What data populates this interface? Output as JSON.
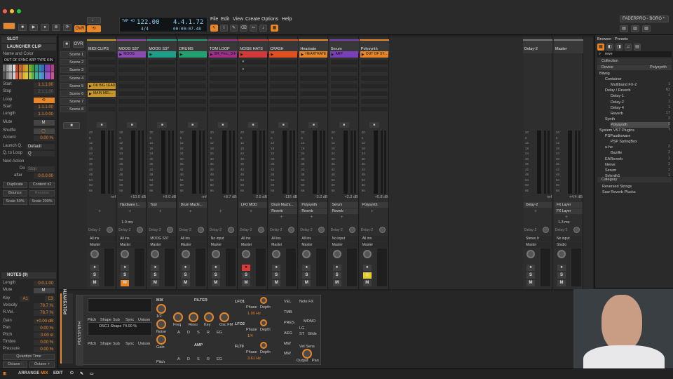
{
  "app": {
    "project_title": "FADERPRO - BORG *",
    "accent": "#e8862a"
  },
  "transport": {
    "ovr": "OVR",
    "tempo": "122.00",
    "sig": "4/4",
    "position": "4.4.1.72",
    "time": "00:00:07.48",
    "tempo_label": "TAP +D"
  },
  "menu": [
    "File",
    "Edit",
    "View",
    "Create",
    "Options",
    "Help"
  ],
  "inspector": {
    "slot": "SLOT",
    "launcher_clip": "LAUNCHER CLIP",
    "name_and_color": "Name and Color",
    "clip_name": "OUT OF SYNC ARP TYPE KIN",
    "start_label": "Start",
    "start": "1.1.1.00",
    "stop_label": "Stop",
    "stop": "2.1.1.00",
    "loop_label": "Loop",
    "loop_start_label": "Start",
    "loop_start": "1.1.1.00",
    "length_label": "Length",
    "length": "1.1.0.00",
    "mute_label": "Mute",
    "mute": "M",
    "shuffle_label": "Shuffle",
    "accent_label": "Accent",
    "accent": "0.00 %",
    "launch_q_label": "Launch Q.",
    "launch_q": "Default",
    "q_loop_label": "Q. to Loop",
    "q_loop": "Q",
    "next_action": "Next Action",
    "do_label": "Do",
    "do": "Stop",
    "after_label": "after",
    "after": "0.0.0.00",
    "buttons": [
      "Duplicate",
      "Content x2",
      "Bounce",
      "Reverse",
      "Scale 50%",
      "Scale 200%"
    ],
    "notes_header": "NOTES (9)",
    "n_length_label": "Length",
    "n_length": "0.0.1.00",
    "n_mute_label": "Mute",
    "n_mute": "M",
    "key_label": "Key",
    "key_from": "A1",
    "key_to": "C3",
    "velocity_label": "Velocity",
    "velocity": "78.7 %",
    "rvel_label": "R.Vel.",
    "rvel": "78.7 %",
    "gain_label": "Gain",
    "gain": "+0.00 dB",
    "pan_label": "Pan",
    "pan": "0.00 %",
    "pitch_label": "Pitch",
    "pitch": "0.00 st",
    "timbre_label": "Timbre",
    "timbre": "0.00 %",
    "pressure_label": "Pressure",
    "pressure": "0.00 %",
    "quantize": "Quantize Time",
    "octave_down": "Octave -",
    "octave_up": "Octave +"
  },
  "scenes": [
    "Scene 1",
    "Scene 2",
    "Scene 3",
    "Scene 4",
    "Scene 5",
    "Scene 6",
    "Scene 7",
    "Scene 8"
  ],
  "tracks": [
    {
      "name": "MIDI CLIPS",
      "color": "#c89628",
      "vol": "-inf",
      "device": "",
      "input": "All ins",
      "output": "Master",
      "clips": {
        "4": "DK BIG LEAD",
        "5": "MAIN MEL..."
      }
    },
    {
      "name": "MOOG S37",
      "color": "#8a4ab0",
      "vol": "+10.0 dB",
      "device": "Hardware I...",
      "input": "All ins",
      "output": "Master",
      "clips": {
        "0": "MOOG"
      },
      "extra": "1.0 ms"
    },
    {
      "name": "MOOG S37",
      "color": "#1f9e8a",
      "vol": "+9.0 dB",
      "device": "Tool",
      "input": "MOOG S37",
      "output": "Master",
      "clips": {
        "0": ""
      }
    },
    {
      "name": "DRUMS",
      "color": "#22a070",
      "vol": "-inf",
      "device": "Drum Machi...",
      "input": "All ins",
      "output": "Master",
      "clips": {
        "0": ""
      }
    },
    {
      "name": "TOM LOOP",
      "color": "#a0308a",
      "vol": "+8.7 dB",
      "device": "",
      "input": "No input",
      "output": "Master",
      "clips": {
        "0": "BR_Perc_Drh"
      }
    },
    {
      "name": "NOISE HATS",
      "color": "#d23a3a",
      "vol": "-2.5 dB",
      "device": "LFO MOD",
      "input": "All ins",
      "output": "Master",
      "clips": {
        "0": ""
      }
    },
    {
      "name": "CRASH",
      "color": "#e05020",
      "vol": "-116 dB",
      "device": "Drum Machi...",
      "device2": "Reverb",
      "input": "All ins",
      "output": "Master",
      "clips": {
        "0": ""
      }
    },
    {
      "name": "Heartrate",
      "color": "#e8862a",
      "vol": "-3.0 dB",
      "device": "Polysynth",
      "device2": "Reverb",
      "input": "All ins",
      "output": "Master",
      "clips": {
        "0": "HEARTRATE"
      }
    },
    {
      "name": "Serum",
      "color": "#7a40b8",
      "vol": "+2.3 dB",
      "device": "Serum",
      "device2": "Reverb",
      "input": "No input",
      "output": "Master",
      "clips": {
        "0": "ARP"
      }
    },
    {
      "name": "Polysynth",
      "color": "#e8862a",
      "vol": "+0.8 dB",
      "device": "Polysynth",
      "input": "All ins",
      "output": "Master",
      "clips": {
        "0": "OUT OF SY..."
      }
    }
  ],
  "fx": [
    {
      "name": "Delay-2",
      "vol": "-inf",
      "device": "Delay-2",
      "input": "Stereo Ir",
      "output": "Master"
    },
    {
      "name": "Master",
      "vol": "+4.4 dB",
      "device": "FX Layer",
      "device2": "FX Layer",
      "input": "No input",
      "output": "Studio",
      "extra": "1.3 ms"
    }
  ],
  "fader_scale": [
    "20",
    "6",
    "12",
    "18",
    "24",
    "30",
    "36",
    "42",
    "48",
    "54",
    "60",
    "66"
  ],
  "delay_label": "Delay-2",
  "browser": {
    "title": "Browser - Presets",
    "search": "reve",
    "collection": "Collection",
    "device": "Device",
    "filter": "Polysynth",
    "items": [
      {
        "label": "Bitwig",
        "count": "",
        "indent": 0
      },
      {
        "label": "Container",
        "count": "",
        "indent": 1
      },
      {
        "label": "Multiband FX-2",
        "count": "1",
        "indent": 2
      },
      {
        "label": "Delay / Reverb",
        "count": "62",
        "indent": 1
      },
      {
        "label": "Delay-1",
        "count": "1",
        "indent": 2
      },
      {
        "label": "Delay-2",
        "count": "1",
        "indent": 2
      },
      {
        "label": "Delay-4",
        "count": "1",
        "indent": 2
      },
      {
        "label": "Reverb",
        "count": "17",
        "indent": 2
      },
      {
        "label": "Synth",
        "count": "2",
        "indent": 1
      },
      {
        "label": "Polysynth",
        "count": "2",
        "indent": 2
      },
      {
        "label": "System VST Plugins",
        "count": "7",
        "indent": 0
      },
      {
        "label": "PSPaudioware",
        "count": "",
        "indent": 1
      },
      {
        "label": "PSP SpringBox",
        "count": "",
        "indent": 2
      },
      {
        "label": "u-he",
        "count": "2",
        "indent": 1
      },
      {
        "label": "Bazille",
        "count": "2",
        "indent": 2
      },
      {
        "label": "EAReverb",
        "count": "1",
        "indent": 1
      },
      {
        "label": "Nerve",
        "count": "1",
        "indent": 1
      },
      {
        "label": "Serum",
        "count": "1",
        "indent": 1
      },
      {
        "label": "Sylenth1",
        "count": "1",
        "indent": 1
      }
    ],
    "category": "Category",
    "results": [
      "Reversed Strings",
      "Saw Reverb Plucks"
    ]
  },
  "device_panel": {
    "track": "POLYSYNTH",
    "name": "POLYSYNTH",
    "mix": "MIX",
    "filter": "FILTER",
    "amp": "AMP",
    "lfo1": "LFO1",
    "lfo2": "LFO2",
    "flt0": "FLT0",
    "osc_labels": [
      "Pitch",
      "Shape",
      "Sub",
      "Sync",
      "Unison"
    ],
    "osc_readout": "OSC1 Shape 74.00 %",
    "filter_labels": [
      "Freq",
      "Reso",
      "Key",
      "Osc FM"
    ],
    "adsr": [
      "A",
      "D",
      "S",
      "R",
      "EG"
    ],
    "mix_labels": [
      "1/2",
      "Noise",
      "Gain"
    ],
    "lfo_vals": [
      "1.00 Hz",
      "1/4",
      "3.61 Hz"
    ],
    "phase": "Phase",
    "depth": "Depth",
    "right": [
      "VEL",
      "TMB",
      "PRES",
      "AEG",
      "MW",
      "NOTE FX",
      "MONO",
      "LG",
      "ST",
      "Glide",
      "Vel Sens",
      "Output",
      "Pan"
    ],
    "notefx": "Note FX"
  },
  "status": [
    "ARRANGE",
    "MIX",
    "EDIT"
  ]
}
